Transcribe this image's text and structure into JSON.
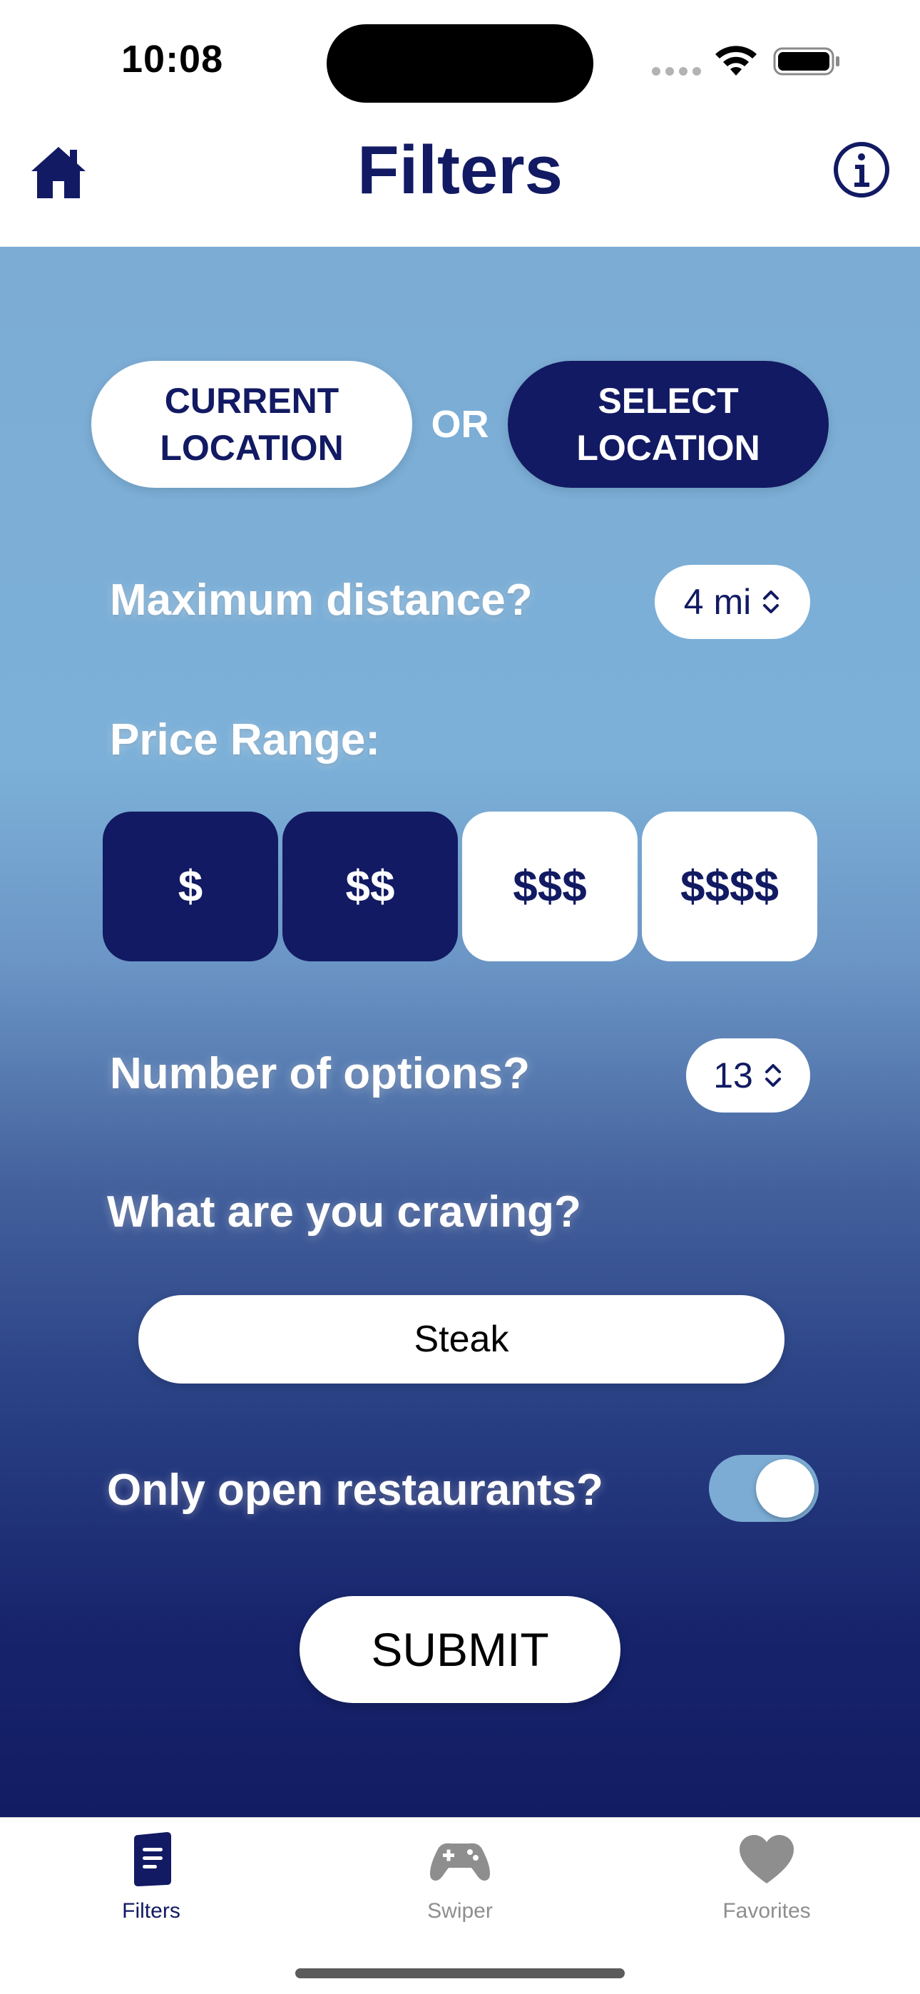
{
  "status_bar": {
    "time": "10:08"
  },
  "header": {
    "title": "Filters",
    "home_icon": "house-icon",
    "info_icon": "info-circle-icon"
  },
  "location": {
    "current_label": "CURRENT LOCATION",
    "or_label": "OR",
    "select_label": "SELECT LOCATION",
    "selected": "select"
  },
  "distance": {
    "label": "Maximum distance?",
    "value": "4 mi"
  },
  "price": {
    "label": "Price Range:",
    "options": [
      {
        "label": "$",
        "selected": true
      },
      {
        "label": "$$",
        "selected": true
      },
      {
        "label": "$$$",
        "selected": false
      },
      {
        "label": "$$$$",
        "selected": false
      }
    ]
  },
  "options_count": {
    "label": "Number of options?",
    "value": "13"
  },
  "craving": {
    "label": "What are you craving?",
    "value": "Steak"
  },
  "open_only": {
    "label": "Only open restaurants?",
    "enabled": true
  },
  "submit_label": "SUBMIT",
  "tabs": [
    {
      "label": "Filters",
      "icon": "book-icon",
      "active": true
    },
    {
      "label": "Swiper",
      "icon": "gamecontroller-icon",
      "active": false
    },
    {
      "label": "Favorites",
      "icon": "heart-icon",
      "active": false
    }
  ],
  "colors": {
    "navy": "#121a63",
    "sky": "#7cacd4",
    "inactive_gray": "#8e8e8e"
  }
}
